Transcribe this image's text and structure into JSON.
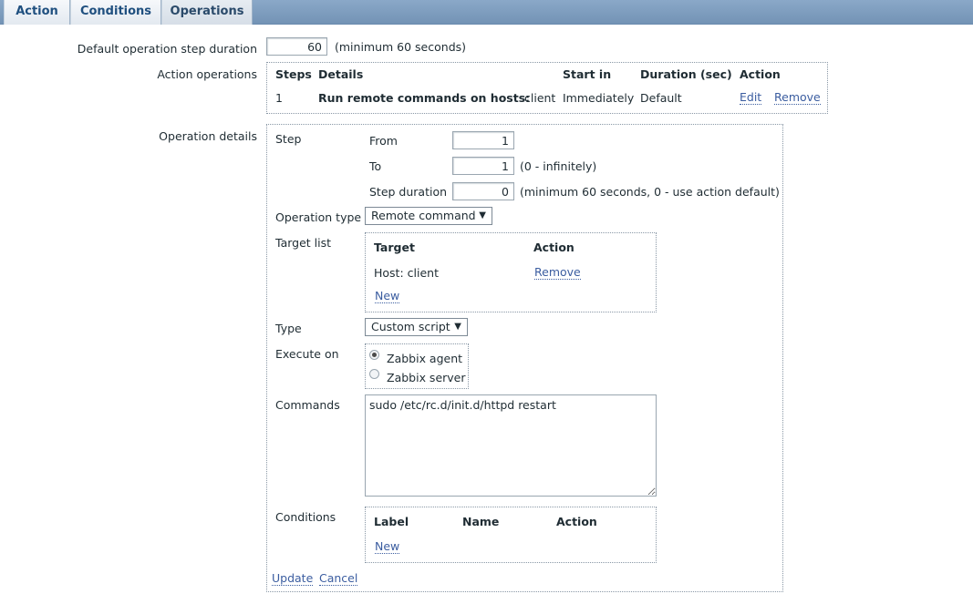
{
  "tabs": [
    {
      "label": "Action"
    },
    {
      "label": "Conditions"
    },
    {
      "label": "Operations"
    }
  ],
  "default_step": {
    "label": "Default operation step duration",
    "value": "60",
    "hint": "(minimum 60 seconds)"
  },
  "action_operations": {
    "label": "Action operations",
    "headers": [
      "Steps",
      "Details",
      "Start in",
      "Duration (sec)",
      "Action"
    ],
    "row": {
      "step": "1",
      "details_bold": "Run remote commands on hosts:",
      "details_rest": "client",
      "start_in": "Immediately",
      "duration": "Default",
      "edit": "Edit",
      "remove": "Remove"
    }
  },
  "operation_details": {
    "label": "Operation details",
    "step_label": "Step",
    "from_label": "From",
    "from_value": "1",
    "to_label": "To",
    "to_value": "1",
    "to_hint": "(0 - infinitely)",
    "duration_label": "Step duration",
    "duration_value": "0",
    "duration_hint": "(minimum 60 seconds, 0 - use action default)",
    "operation_type_label": "Operation type",
    "operation_type_value": "Remote command",
    "target_list_label": "Target list",
    "target_headers": [
      "Target",
      "Action"
    ],
    "target_row": {
      "target": "Host: client",
      "action": "Remove"
    },
    "target_new": "New",
    "type_label": "Type",
    "type_value": "Custom script",
    "execute_on_label": "Execute on",
    "execute_options": [
      "Zabbix agent",
      "Zabbix server"
    ],
    "commands_label": "Commands",
    "commands_value": "sudo /etc/rc.d/init.d/httpd restart",
    "conditions_label": "Conditions",
    "conditions_headers": [
      "Label",
      "Name",
      "Action"
    ],
    "conditions_new": "New",
    "update": "Update",
    "cancel": "Cancel"
  }
}
